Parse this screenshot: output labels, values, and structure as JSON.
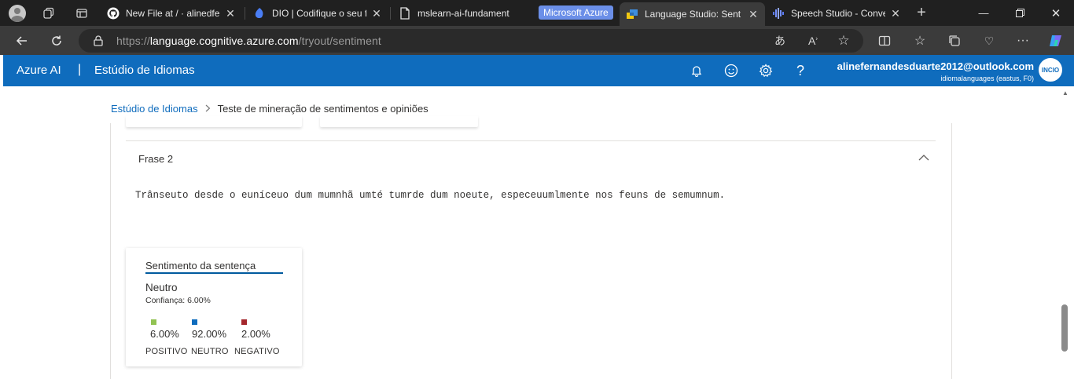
{
  "browser": {
    "tabs": [
      {
        "title": "New File at / · alinedfer",
        "favicon": "github-icon"
      },
      {
        "title": "DIO | Codifique o seu f",
        "favicon": "dio-icon"
      },
      {
        "title": "mslearn-ai-fundament",
        "favicon": "page-icon"
      },
      {
        "title": "Language Studio: Sent",
        "favicon": "language-studio-icon",
        "active": true
      },
      {
        "title": "Speech Studio - Conve",
        "favicon": "speech-studio-icon"
      }
    ],
    "tab_group_label": "Microsoft Azure",
    "url_prefix": "https://",
    "url_host": "language.cognitive.azure.com",
    "url_path": "/tryout/sentiment"
  },
  "header": {
    "brand": "Azure AI",
    "divider": "|",
    "studio": "Estúdio de Idiomas",
    "account_email": "alinefernandesduarte2012@outlook.com",
    "account_sub": "idiomalanguages (eastus, F0)",
    "avatar_text": "INCIO"
  },
  "breadcrumb": {
    "root": "Estúdio de Idiomas",
    "current": "Teste de mineração de sentimentos e opiniões"
  },
  "phrase": {
    "title": "Frase 2",
    "text": "Trânseuto desde o euníceuo dum mumnhã umté tumrde dum noeute, especeuumlmente nos feuns de semumnum."
  },
  "sentiment_card": {
    "title": "Sentimento da sentença",
    "value": "Neutro",
    "confidence": "Confiança: 6.00%",
    "scores": [
      {
        "value": "6.00%",
        "label": "POSITIVO",
        "color": "#92c353"
      },
      {
        "value": "92.00%",
        "label": "NEUTRO",
        "color": "#0f6cbd"
      },
      {
        "value": "2.00%",
        "label": "NEGATIVO",
        "color": "#a4262c"
      }
    ]
  },
  "colors": {
    "azure_header": "#0f6cbd",
    "browser_dark": "#202020"
  }
}
